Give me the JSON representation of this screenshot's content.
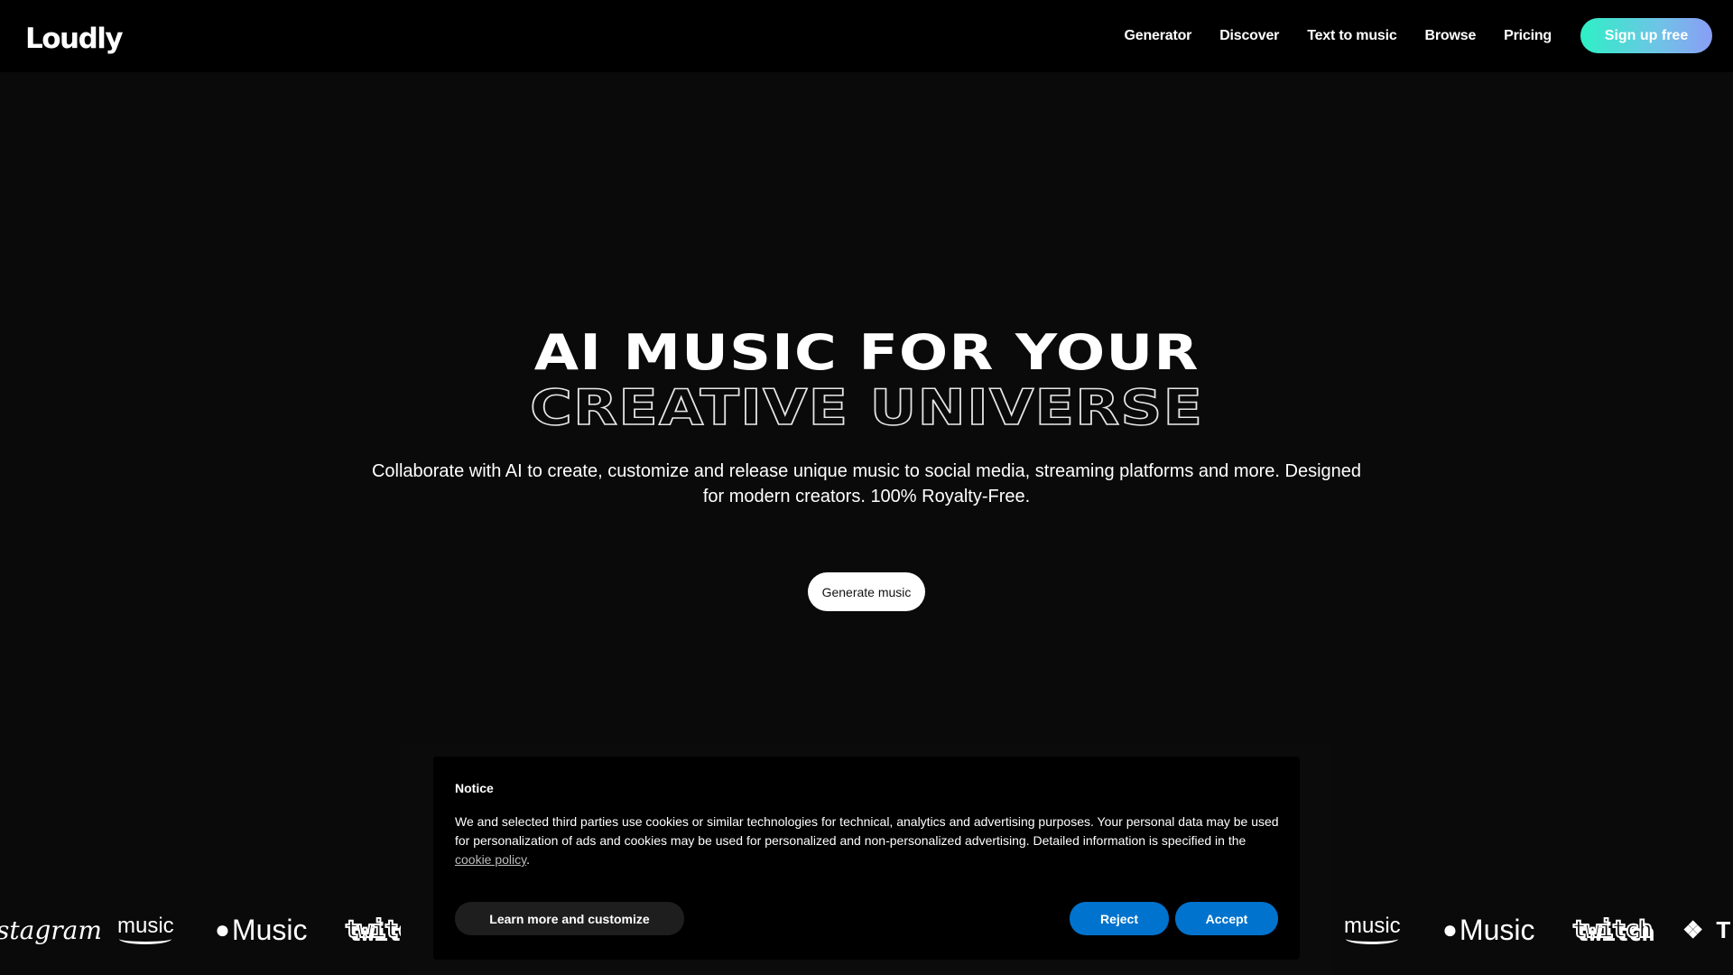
{
  "header": {
    "logo": "Loudly",
    "nav": [
      {
        "label": "Generator"
      },
      {
        "label": "Discover"
      },
      {
        "label": "Text to music"
      },
      {
        "label": "Browse"
      },
      {
        "label": "Pricing"
      }
    ],
    "signup_label": "Sign up free"
  },
  "hero": {
    "title_line1": "AI MUSIC FOR YOUR",
    "title_line2": "CREATIVE UNIVERSE",
    "subtitle": "Collaborate with AI to create, customize and release unique music to social media, streaming platforms and more. Designed for modern creators. 100% Royalty-Free.",
    "cta_label": "Generate music"
  },
  "brands": {
    "instagram": "stagram",
    "amazon": "music",
    "apple": "Music",
    "apple_glyph": "",
    "twitch": "twitch",
    "tidal_glyph": "❖",
    "tidal": "T"
  },
  "cookie": {
    "title": "Notice",
    "text": "We and selected third parties use cookies or similar technologies for technical, analytics and advertising purposes. Your personal data may be used for personalization of ads and cookies may be used for personalized and non-personalized advertising. Detailed information is specified in the ",
    "link_label": "cookie policy",
    "text_end": ".",
    "learn_label": "Learn more and customize",
    "reject_label": "Reject",
    "accept_label": "Accept"
  },
  "colors": {
    "accent_blue": "#0073ce",
    "signup_gradient_start": "#2ef0c6",
    "signup_gradient_end": "#8a9df5",
    "background": "#0a0a0a"
  }
}
